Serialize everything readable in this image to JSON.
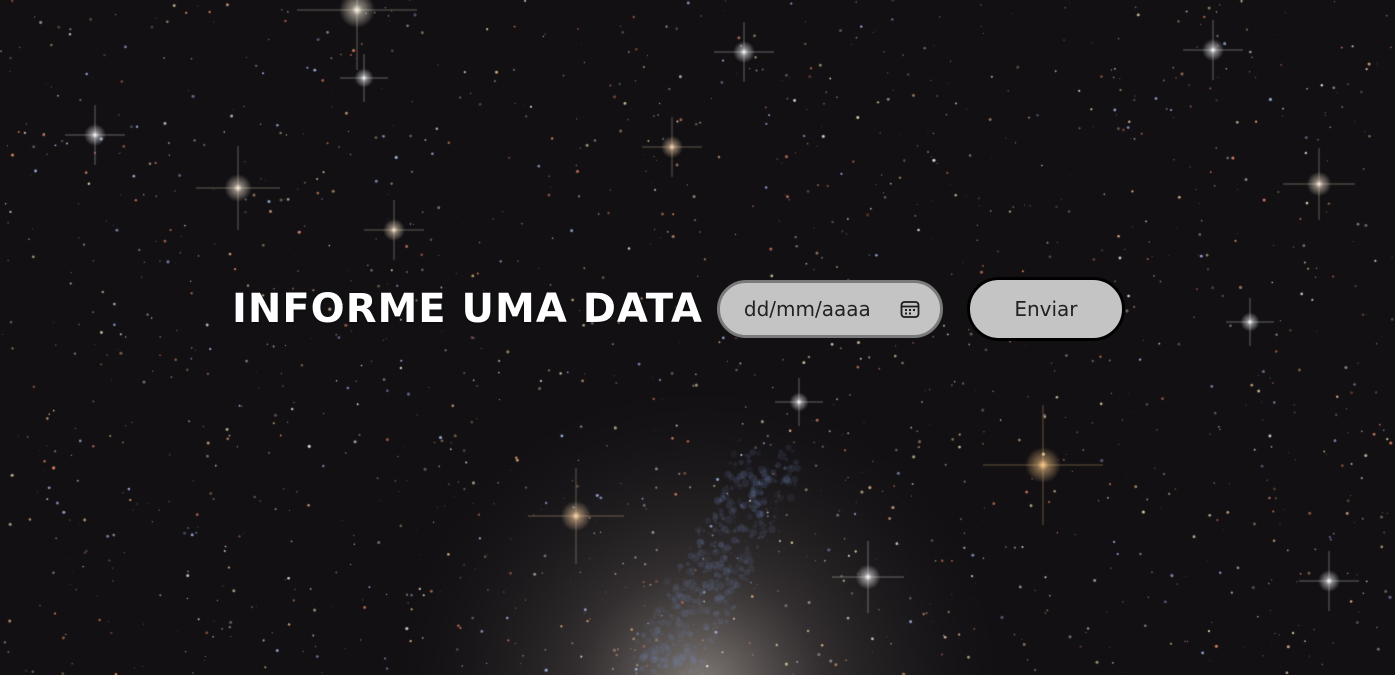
{
  "page": {
    "title": "INFORME UMA DATA"
  },
  "date_input": {
    "placeholder": "dd/mm/aaaa",
    "icon": "calendar-icon"
  },
  "submit": {
    "label": "Enviar"
  },
  "colors": {
    "background": "#121013",
    "title_text": "#ffffff",
    "control_fill": "#c4c4c4",
    "input_border": "#7a7a7a",
    "button_border": "#000000",
    "control_text": "#222222"
  }
}
